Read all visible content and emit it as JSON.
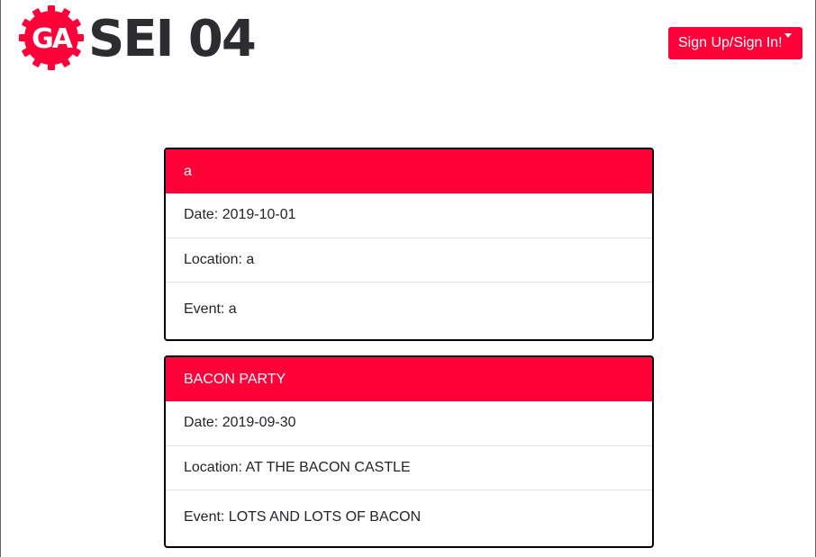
{
  "header": {
    "logo_text": "GA",
    "brand_title": "SEI 04",
    "auth_button_label": "Sign Up/Sign In!"
  },
  "colors": {
    "accent": "#ff0038",
    "text_dark": "#2b2d31"
  },
  "events": [
    {
      "title": "a",
      "date": "Date: 2019-10-01",
      "location": "Location: a",
      "event": "Event: a"
    },
    {
      "title": "BACON PARTY",
      "date": "Date: 2019-09-30",
      "location": "Location: AT THE BACON CASTLE",
      "event": "Event: LOTS AND LOTS OF BACON"
    }
  ]
}
